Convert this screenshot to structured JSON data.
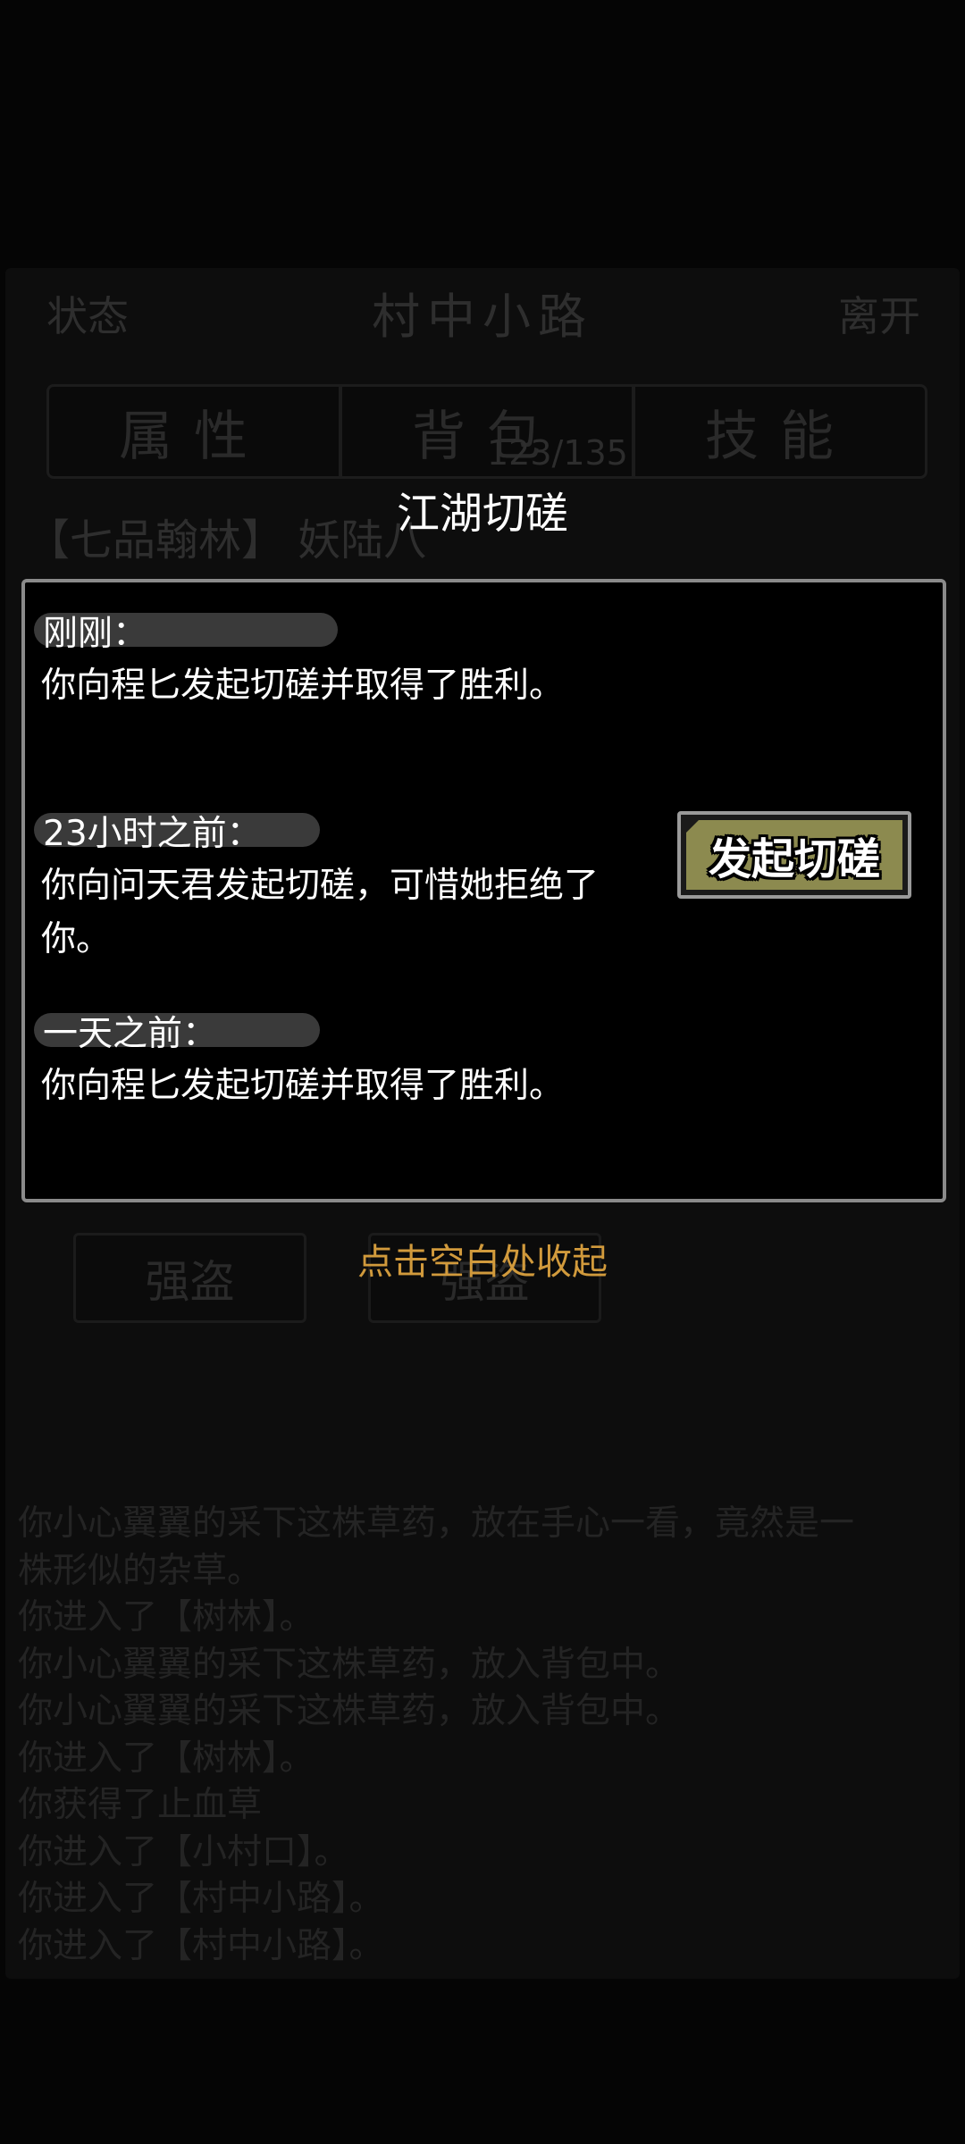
{
  "background": {
    "status_label": "状态",
    "location_title": "村中小路",
    "leave_label": "离开",
    "tabs": [
      "属性",
      "背包",
      "技能"
    ],
    "inventory_count": "123/135",
    "rank_text": "【七品翰林】 妖陆八",
    "bandits": [
      "强盗",
      "强盗"
    ],
    "log": [
      "你小心翼翼的采下这株草药，放在手心一看，竟然是一",
      "株形似的杂草。",
      "你进入了【树林】。",
      "你小心翼翼的采下这株草药，放入背包中。",
      "你小心翼翼的采下这株草药，放入背包中。",
      "你进入了【树林】。",
      "你获得了止血草",
      "你进入了【小村口】。",
      "你进入了【村中小路】。",
      "你进入了【村中小路】。"
    ]
  },
  "dialog": {
    "title": "江湖切磋",
    "entries": [
      {
        "time": "刚刚：",
        "text": "你向程匕发起切磋并取得了胜利。"
      },
      {
        "time": "23小时之前：",
        "text": "你向问天君发起切磋，可惜她拒绝了你。"
      },
      {
        "time": "一天之前：",
        "text": "你向程匕发起切磋并取得了胜利。"
      }
    ],
    "spar_button": "发起切磋",
    "dismiss_hint": "点击空白处收起"
  },
  "colors": {
    "accent_button": "#8c8a4f",
    "hint": "#d19a3c"
  }
}
